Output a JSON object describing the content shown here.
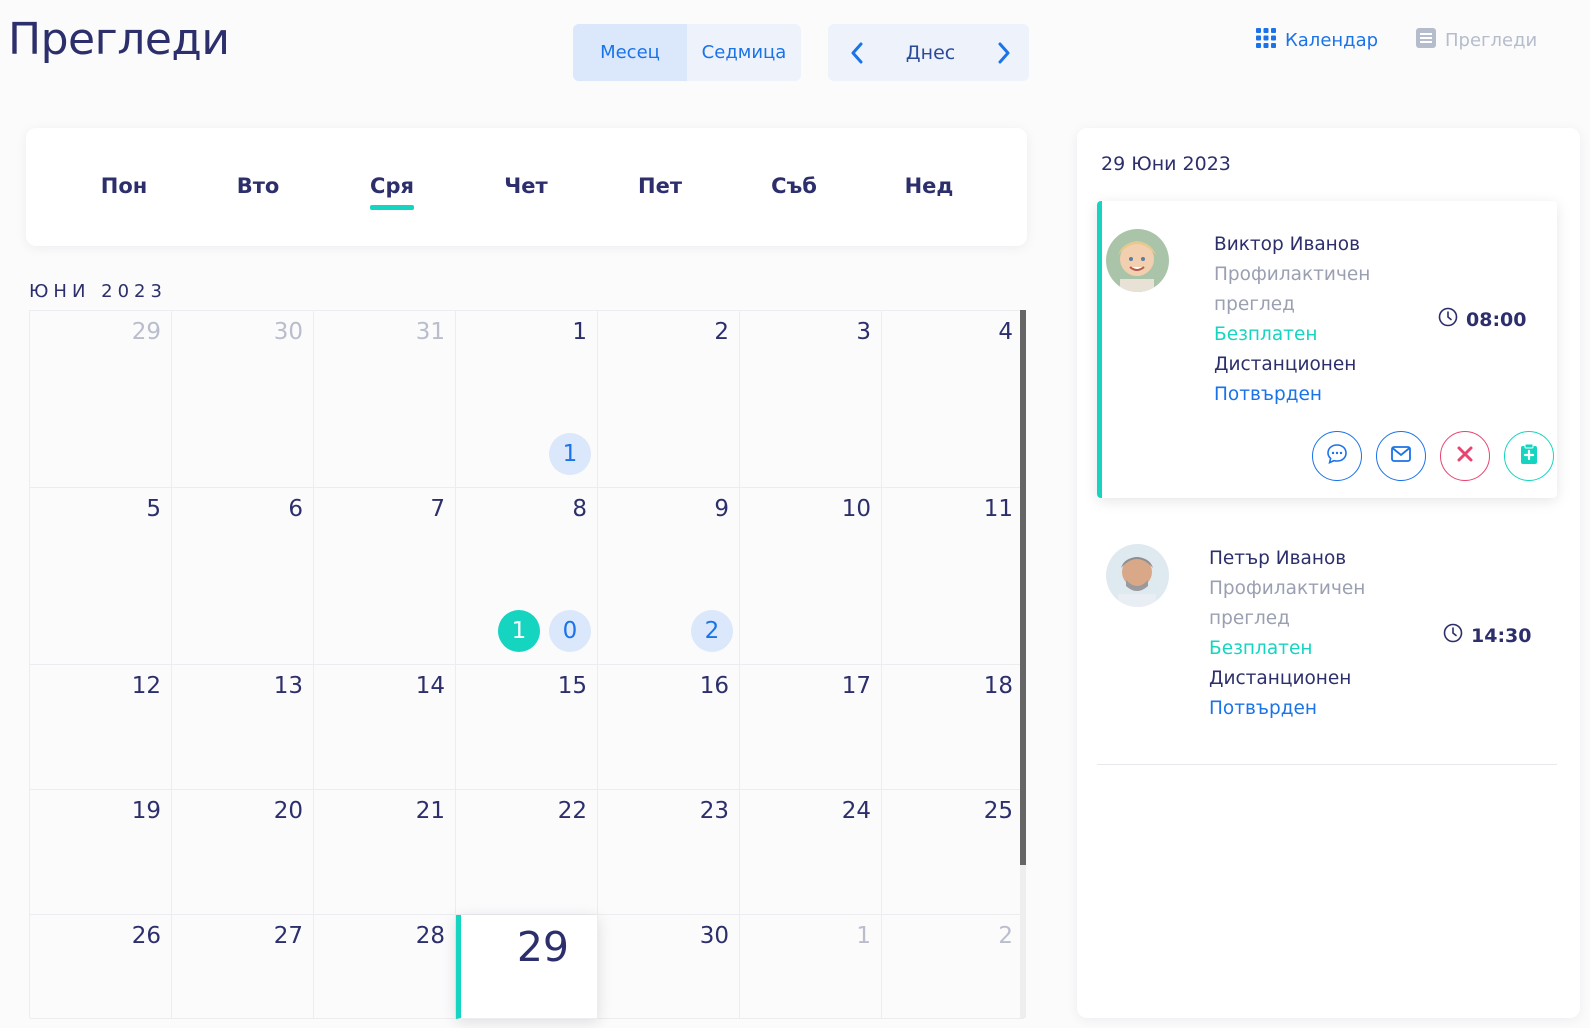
{
  "page": {
    "title": "Прегледи"
  },
  "view_toggle": {
    "month": "Месец",
    "week": "Седмица",
    "active": "month"
  },
  "nav": {
    "today": "Днес"
  },
  "top_links": {
    "calendar": "Календар",
    "list": "Прегледи"
  },
  "weekdays": [
    "Пон",
    "Вто",
    "Сря",
    "Чет",
    "Пет",
    "Съб",
    "Нед"
  ],
  "active_weekday": "Сря",
  "month_label": "ЮНИ 2023",
  "calendar": {
    "weeks": [
      [
        {
          "day": "29",
          "muted": true
        },
        {
          "day": "30",
          "muted": true
        },
        {
          "day": "31",
          "muted": true
        },
        {
          "day": "1"
        },
        {
          "day": "2"
        },
        {
          "day": "3"
        },
        {
          "day": "4"
        }
      ],
      [
        {
          "day": "5"
        },
        {
          "day": "6"
        },
        {
          "day": "7"
        },
        {
          "day": "8"
        },
        {
          "day": "9"
        },
        {
          "day": "10"
        },
        {
          "day": "11"
        }
      ],
      [
        {
          "day": "12"
        },
        {
          "day": "13"
        },
        {
          "day": "14"
        },
        {
          "day": "15"
        },
        {
          "day": "16"
        },
        {
          "day": "17"
        },
        {
          "day": "18"
        }
      ],
      [
        {
          "day": "19"
        },
        {
          "day": "20"
        },
        {
          "day": "21"
        },
        {
          "day": "22"
        },
        {
          "day": "23"
        },
        {
          "day": "24"
        },
        {
          "day": "25"
        }
      ],
      [
        {
          "day": "26"
        },
        {
          "day": "27"
        },
        {
          "day": "28"
        },
        {
          "day": "29",
          "today": true
        },
        {
          "day": "30"
        },
        {
          "day": "1",
          "muted": true
        },
        {
          "day": "2",
          "muted": true
        }
      ]
    ],
    "badges": [
      {
        "week": 0,
        "col": 3,
        "slot": 0,
        "value": "1",
        "style": "blue"
      },
      {
        "week": 1,
        "col": 3,
        "slot": 1,
        "value": "1",
        "style": "teal"
      },
      {
        "week": 1,
        "col": 3,
        "slot": 0,
        "value": "0",
        "style": "blue"
      },
      {
        "week": 1,
        "col": 4,
        "slot": 0,
        "value": "2",
        "style": "blue"
      }
    ]
  },
  "side_panel": {
    "date": "29 Юни 2023",
    "appointments": [
      {
        "name": "Виктор Иванов",
        "type": "Профилактичен преглед",
        "price": "Безплатен",
        "mode": "Дистанционен",
        "status": "Потвърден",
        "time": "08:00"
      },
      {
        "name": "Петър Иванов",
        "type": "Профилактичен преглед",
        "price": "Безплатен",
        "mode": "Дистанционен",
        "status": "Потвърден",
        "time": "14:30"
      }
    ]
  },
  "colors": {
    "accent": "#16d5c0",
    "primary": "#1a73e8",
    "navy": "#2c2f6b",
    "danger": "#e8446f"
  },
  "icons": [
    "chevron-left-icon",
    "chevron-right-icon",
    "grid-icon",
    "list-icon",
    "clock-icon",
    "chat-icon",
    "mail-icon",
    "close-icon",
    "clipboard-plus-icon"
  ]
}
